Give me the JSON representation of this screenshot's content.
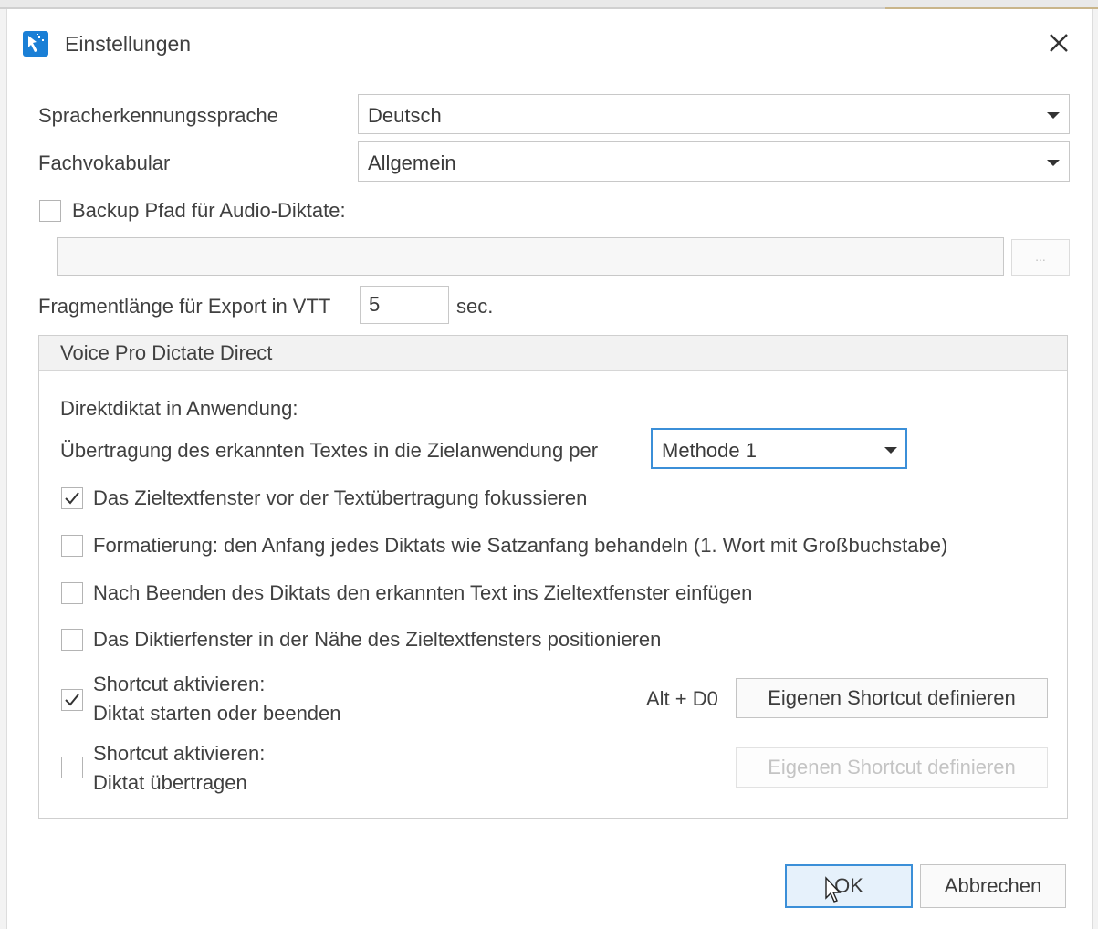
{
  "dialog": {
    "title": "Einstellungen",
    "close_glyph": "✕",
    "icon": "app-icon"
  },
  "general": {
    "language_label": "Spracherkennungssprache",
    "language_value": "Deutsch",
    "vocab_label": "Fachvokabular",
    "vocab_value": "Allgemein",
    "backup_label": "Backup Pfad für Audio-Diktate:",
    "backup_checked": false,
    "backup_path": "",
    "browse_label": "...",
    "fragment_label": "Fragmentlänge für Export in VTT",
    "fragment_value": "5",
    "fragment_unit": "sec."
  },
  "direct": {
    "group_title": "Voice Pro Dictate Direct",
    "direct_label": "Direktdiktat in Anwendung:",
    "transfer_label": "Übertragung des erkannten Textes in die Zielanwendung per",
    "transfer_value": "Methode 1",
    "options": [
      {
        "label": "Das Zieltextfenster vor der Textübertragung fokussieren",
        "checked": true
      },
      {
        "label": "Formatierung: den Anfang jedes Diktats wie Satzanfang behandeln (1. Wort mit Großbuchstabe)",
        "checked": false
      },
      {
        "label": "Nach Beenden des Diktats den erkannten Text ins Zieltextfenster einfügen",
        "checked": false
      },
      {
        "label": "Das Diktierfenster in der Nähe des Zieltextfensters positionieren",
        "checked": false
      }
    ],
    "shortcut1": {
      "line1": "Shortcut aktivieren:",
      "line2": "Diktat starten oder beenden",
      "checked": true,
      "keys": "Alt + D0",
      "button": "Eigenen Shortcut definieren"
    },
    "shortcut2": {
      "line1": "Shortcut aktivieren:",
      "line2": "Diktat übertragen",
      "checked": false,
      "button": "Eigenen Shortcut definieren"
    }
  },
  "footer": {
    "ok": "OK",
    "cancel": "Abbrechen"
  },
  "colors": {
    "accent": "#3b8fd8",
    "app_icon": "#1a7fd6"
  }
}
